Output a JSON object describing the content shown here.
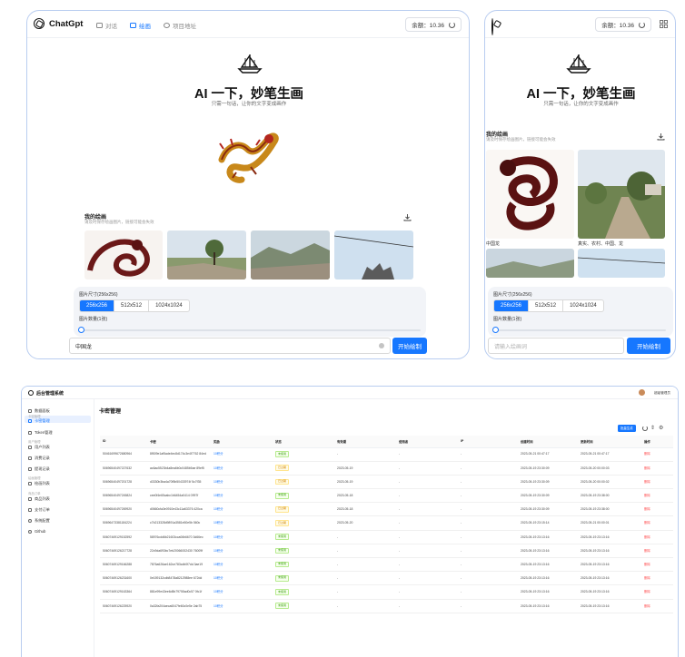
{
  "colors": {
    "accent": "#1677ff",
    "frame": "#b9cdf0"
  },
  "desktop_app": {
    "brand": "ChatGpt",
    "nav": [
      {
        "label": "对话",
        "icon": "chat-icon",
        "active": false
      },
      {
        "label": "绘画",
        "icon": "image-icon",
        "active": true
      },
      {
        "label": "项目地址",
        "icon": "github-icon",
        "active": false
      }
    ],
    "balance_label": "余额：10.36",
    "hero_title": "AI 一下，妙笔生画",
    "hero_subtitle": "只需一句话，让你的文字变成画作",
    "gallery_title": "我的绘画",
    "gallery_subtitle": "请及时保存绘画图片，链接可能会失效",
    "size_label": "图片尺寸(256x256)",
    "sizes": [
      "256x256",
      "512x512",
      "1024x1024"
    ],
    "count_label": "图片数量(1张)",
    "prompt_value": "中国龙",
    "submit_label": "开始绘制"
  },
  "mobile_app": {
    "balance_label": "余额：10.36",
    "hero_title": "AI 一下，妙笔生画",
    "hero_subtitle": "只需一句话，让你的文字变成画作",
    "gallery_title": "我的绘画",
    "gallery_subtitle": "请及时保存绘画图片，链接可能会失效",
    "captions": [
      "中国龙",
      "真实、农村、中国、龙"
    ],
    "size_label": "图片尺寸(256x256)",
    "sizes": [
      "256x256",
      "512x512",
      "1024x1024"
    ],
    "count_label": "图片数量(1张)",
    "prompt_placeholder": "请输入绘画词",
    "submit_label": "开始绘制"
  },
  "admin": {
    "brand": "后台管理系统",
    "user": "超级管理员",
    "page_title": "卡密管理",
    "generate_label": "批量生成",
    "sidebar": [
      {
        "type": "item",
        "label": "数据面板",
        "active": false
      },
      {
        "type": "group",
        "label": "卡密管理"
      },
      {
        "type": "item",
        "label": "卡密管理",
        "active": true
      },
      {
        "type": "item",
        "label": "Token管理",
        "active": false
      },
      {
        "type": "group",
        "label": "用户管理"
      },
      {
        "type": "item",
        "label": "用户列表",
        "active": false
      },
      {
        "type": "item",
        "label": "消费记录",
        "active": false
      },
      {
        "type": "item",
        "label": "提现记录",
        "active": false
      },
      {
        "type": "group",
        "label": "绘画管理"
      },
      {
        "type": "item",
        "label": "绘画列表",
        "active": false
      },
      {
        "type": "group",
        "label": "商品订单"
      },
      {
        "type": "item",
        "label": "商品列表",
        "active": false
      },
      {
        "type": "item",
        "label": "支付订单",
        "active": false
      },
      {
        "type": "item",
        "label": "系统配置",
        "active": false
      },
      {
        "type": "item",
        "label": "Github",
        "active": false
      }
    ],
    "columns": [
      "ID",
      "卡密",
      "奖励",
      "状态",
      "有效期",
      "使用者",
      "IP",
      "创建时间",
      "更新时间",
      "操作"
    ],
    "rows": [
      [
        "50461699672680964",
        "8f509e1af5ade4ec8d174c3e4f7762 84ed",
        "10积分",
        "未使用",
        "-",
        "-",
        "-",
        "2023-05-21 00:47:17",
        "2023-05-21 00:47:17",
        "删除"
      ],
      [
        "50696540497227632",
        "ac6ac5523b4a8ea6b0c0485b5ae 89ef5",
        "10积分",
        "已过期",
        "2023-05-19",
        "-",
        "-",
        "2023-05-19 23:30:09",
        "2023-05-20 00:00:03",
        "删除"
      ],
      [
        "50696540497201728",
        "d3330b3ba4a70f5b50433974f 5c7f35",
        "10积分",
        "已过期",
        "2023-05-19",
        "-",
        "-",
        "2023-05-19 23:30:09",
        "2023-05-20 00:00:02",
        "删除"
      ],
      [
        "50696540497245824",
        "cee0f4e65cabc1b6454a0414 0997f",
        "10积分",
        "未使用",
        "2023-05-18",
        "-",
        "-",
        "2023-05-19 23:30:09",
        "2023-05-19 23:38:00",
        "删除"
      ],
      [
        "50696540497269920",
        "d0660cfa3e0910e43c11a63376 420ca",
        "10积分",
        "已过期",
        "2023-05-18",
        "-",
        "-",
        "2023-05-19 23:30:09",
        "2023-05-19 23:38:00",
        "删除"
      ],
      [
        "50696473381184224",
        "c7b213328d9891a3581e50e5b 560c",
        "10积分",
        "已过期",
        "2023-05-20",
        "-",
        "-",
        "2023-05-19 23:15:14",
        "2023-05-21 00:00:01",
        "删除"
      ],
      [
        "50607469129152592",
        "58976cdd6b21603cca06b6670 3d66ec",
        "10积分",
        "未使用",
        "-",
        "-",
        "-",
        "2023-05-19 23:13:16",
        "2023-05-19 23:13:16",
        "删除"
      ],
      [
        "50607469126217728",
        "22c9da693bc7eb20066002430 76009f",
        "10积分",
        "未使用",
        "-",
        "-",
        "-",
        "2023-05-19 23:13:16",
        "2023-05-19 23:13:16",
        "删除"
      ],
      [
        "50607469129166288",
        "7876a626ae162ce783cdb0f7dd 3ae19",
        "10积分",
        "未使用",
        "-",
        "-",
        "-",
        "2023-05-19 23:13:16",
        "2023-05-19 23:13:16",
        "删除"
      ],
      [
        "50607469126231600",
        "0e159132cdb8478a8212988ee 672dd",
        "10积分",
        "未使用",
        "-",
        "-",
        "-",
        "2023-05-19 23:13:16",
        "2023-05-19 23:13:16",
        "删除"
      ],
      [
        "50607469129163364",
        "881e99e43ee6d5b79755ad0c57 0fc1f",
        "10积分",
        "未使用",
        "-",
        "-",
        "-",
        "2023-05-19 23:13:16",
        "2023-05-19 23:13:16",
        "删除"
      ],
      [
        "50607469126225920",
        "0a32fa204aeca6047fe60c0e5e 2ab75",
        "10积分",
        "未使用",
        "-",
        "-",
        "-",
        "2023-05-19 23:13:16",
        "2023-05-19 23:13:16",
        "删除"
      ]
    ]
  }
}
